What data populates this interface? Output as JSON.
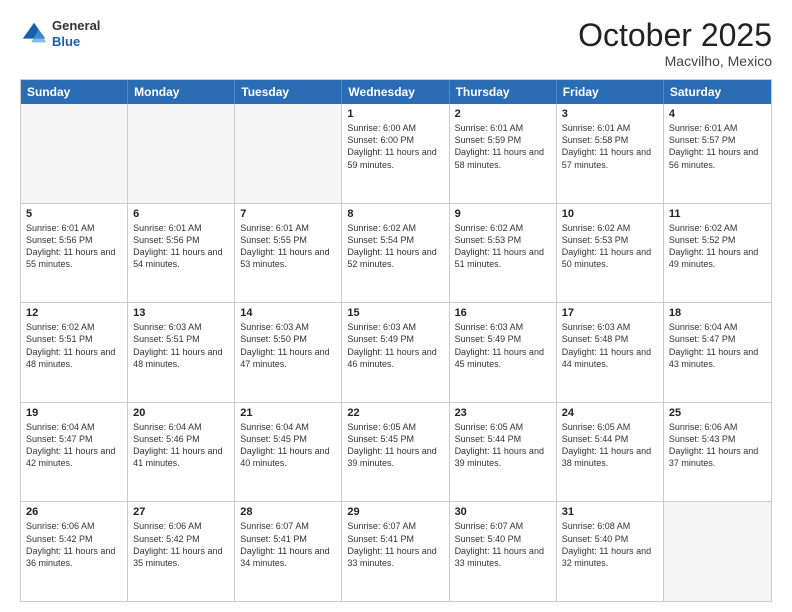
{
  "logo": {
    "general": "General",
    "blue": "Blue"
  },
  "header": {
    "month": "October 2025",
    "location": "Macvilho, Mexico"
  },
  "weekdays": [
    "Sunday",
    "Monday",
    "Tuesday",
    "Wednesday",
    "Thursday",
    "Friday",
    "Saturday"
  ],
  "weeks": [
    [
      {
        "day": "",
        "empty": true
      },
      {
        "day": "",
        "empty": true
      },
      {
        "day": "",
        "empty": true
      },
      {
        "day": "1",
        "sunrise": "6:00 AM",
        "sunset": "6:00 PM",
        "daylight": "11 hours and 59 minutes."
      },
      {
        "day": "2",
        "sunrise": "6:01 AM",
        "sunset": "5:59 PM",
        "daylight": "11 hours and 58 minutes."
      },
      {
        "day": "3",
        "sunrise": "6:01 AM",
        "sunset": "5:58 PM",
        "daylight": "11 hours and 57 minutes."
      },
      {
        "day": "4",
        "sunrise": "6:01 AM",
        "sunset": "5:57 PM",
        "daylight": "11 hours and 56 minutes."
      }
    ],
    [
      {
        "day": "5",
        "sunrise": "6:01 AM",
        "sunset": "5:56 PM",
        "daylight": "11 hours and 55 minutes."
      },
      {
        "day": "6",
        "sunrise": "6:01 AM",
        "sunset": "5:56 PM",
        "daylight": "11 hours and 54 minutes."
      },
      {
        "day": "7",
        "sunrise": "6:01 AM",
        "sunset": "5:55 PM",
        "daylight": "11 hours and 53 minutes."
      },
      {
        "day": "8",
        "sunrise": "6:02 AM",
        "sunset": "5:54 PM",
        "daylight": "11 hours and 52 minutes."
      },
      {
        "day": "9",
        "sunrise": "6:02 AM",
        "sunset": "5:53 PM",
        "daylight": "11 hours and 51 minutes."
      },
      {
        "day": "10",
        "sunrise": "6:02 AM",
        "sunset": "5:53 PM",
        "daylight": "11 hours and 50 minutes."
      },
      {
        "day": "11",
        "sunrise": "6:02 AM",
        "sunset": "5:52 PM",
        "daylight": "11 hours and 49 minutes."
      }
    ],
    [
      {
        "day": "12",
        "sunrise": "6:02 AM",
        "sunset": "5:51 PM",
        "daylight": "11 hours and 48 minutes."
      },
      {
        "day": "13",
        "sunrise": "6:03 AM",
        "sunset": "5:51 PM",
        "daylight": "11 hours and 48 minutes."
      },
      {
        "day": "14",
        "sunrise": "6:03 AM",
        "sunset": "5:50 PM",
        "daylight": "11 hours and 47 minutes."
      },
      {
        "day": "15",
        "sunrise": "6:03 AM",
        "sunset": "5:49 PM",
        "daylight": "11 hours and 46 minutes."
      },
      {
        "day": "16",
        "sunrise": "6:03 AM",
        "sunset": "5:49 PM",
        "daylight": "11 hours and 45 minutes."
      },
      {
        "day": "17",
        "sunrise": "6:03 AM",
        "sunset": "5:48 PM",
        "daylight": "11 hours and 44 minutes."
      },
      {
        "day": "18",
        "sunrise": "6:04 AM",
        "sunset": "5:47 PM",
        "daylight": "11 hours and 43 minutes."
      }
    ],
    [
      {
        "day": "19",
        "sunrise": "6:04 AM",
        "sunset": "5:47 PM",
        "daylight": "11 hours and 42 minutes."
      },
      {
        "day": "20",
        "sunrise": "6:04 AM",
        "sunset": "5:46 PM",
        "daylight": "11 hours and 41 minutes."
      },
      {
        "day": "21",
        "sunrise": "6:04 AM",
        "sunset": "5:45 PM",
        "daylight": "11 hours and 40 minutes."
      },
      {
        "day": "22",
        "sunrise": "6:05 AM",
        "sunset": "5:45 PM",
        "daylight": "11 hours and 39 minutes."
      },
      {
        "day": "23",
        "sunrise": "6:05 AM",
        "sunset": "5:44 PM",
        "daylight": "11 hours and 39 minutes."
      },
      {
        "day": "24",
        "sunrise": "6:05 AM",
        "sunset": "5:44 PM",
        "daylight": "11 hours and 38 minutes."
      },
      {
        "day": "25",
        "sunrise": "6:06 AM",
        "sunset": "5:43 PM",
        "daylight": "11 hours and 37 minutes."
      }
    ],
    [
      {
        "day": "26",
        "sunrise": "6:06 AM",
        "sunset": "5:42 PM",
        "daylight": "11 hours and 36 minutes."
      },
      {
        "day": "27",
        "sunrise": "6:06 AM",
        "sunset": "5:42 PM",
        "daylight": "11 hours and 35 minutes."
      },
      {
        "day": "28",
        "sunrise": "6:07 AM",
        "sunset": "5:41 PM",
        "daylight": "11 hours and 34 minutes."
      },
      {
        "day": "29",
        "sunrise": "6:07 AM",
        "sunset": "5:41 PM",
        "daylight": "11 hours and 33 minutes."
      },
      {
        "day": "30",
        "sunrise": "6:07 AM",
        "sunset": "5:40 PM",
        "daylight": "11 hours and 33 minutes."
      },
      {
        "day": "31",
        "sunrise": "6:08 AM",
        "sunset": "5:40 PM",
        "daylight": "11 hours and 32 minutes."
      },
      {
        "day": "",
        "empty": true
      }
    ]
  ],
  "labels": {
    "sunrise": "Sunrise:",
    "sunset": "Sunset:",
    "daylight": "Daylight hours"
  }
}
